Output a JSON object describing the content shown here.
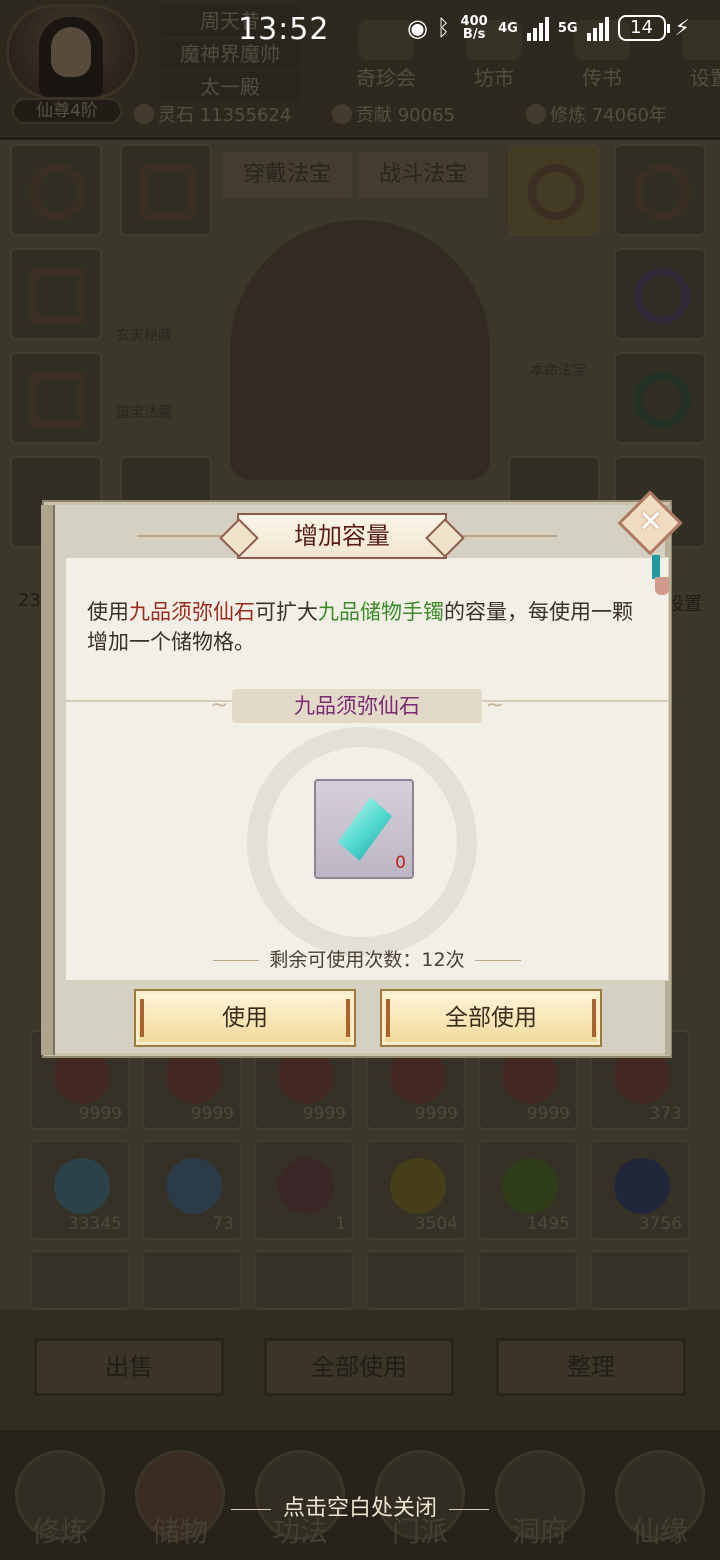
{
  "status_bar": {
    "time": "13:52",
    "net_speed": "400 B/s",
    "net_4g": "4G",
    "net_5g": "5G",
    "battery": "14"
  },
  "header": {
    "names": [
      "周天昔",
      "魔神界魔帅",
      "太一殿"
    ],
    "rank": "仙尊4阶",
    "nav": [
      "奇珍会",
      "坊市",
      "传书",
      "设置"
    ],
    "resources": {
      "spirit_stone": "灵石 11355624",
      "contribution": "贡献 90065",
      "cultivation": "修炼 74060年"
    }
  },
  "background": {
    "tabs": [
      "穿戴法宝",
      "战斗法宝"
    ],
    "side_labels": [
      "玄天秘藏",
      "道宝法囊",
      "本命法宝"
    ],
    "item_counts_row1": [
      "9999",
      "9999",
      "9999",
      "9999",
      "9999",
      "373"
    ],
    "item_counts_row2": [
      "33345",
      "73",
      "1",
      "3504",
      "1495",
      "3756"
    ],
    "bottom_buttons": [
      "出售",
      "全部使用",
      "整理"
    ],
    "bottom_nav": [
      "修炼",
      "储物",
      "功法",
      "门派",
      "洞府",
      "仙缘"
    ],
    "close_hint": "点击空白处关闭",
    "partial_left": "23",
    "partial_right": "设置"
  },
  "dialog": {
    "title": "增加容量",
    "close_label": "✕",
    "description": {
      "prefix": "使用",
      "item_red": "九品须弥仙石",
      "middle": "可扩大",
      "item_green": "九品储物手镯",
      "suffix": "的容量，每使用一颗增加一个储物格。"
    },
    "section_title": "九品须弥仙石",
    "item_count": "0",
    "remaining": "剩余可使用次数：12次",
    "use_button": "使用",
    "use_all_button": "全部使用"
  },
  "colors": {
    "accent_red": "#9a2b1e",
    "accent_green": "#3c8a2a",
    "section_purple": "#7a2b72",
    "count_red": "#c2221a",
    "gem_cyan": "#4ed7cd"
  }
}
